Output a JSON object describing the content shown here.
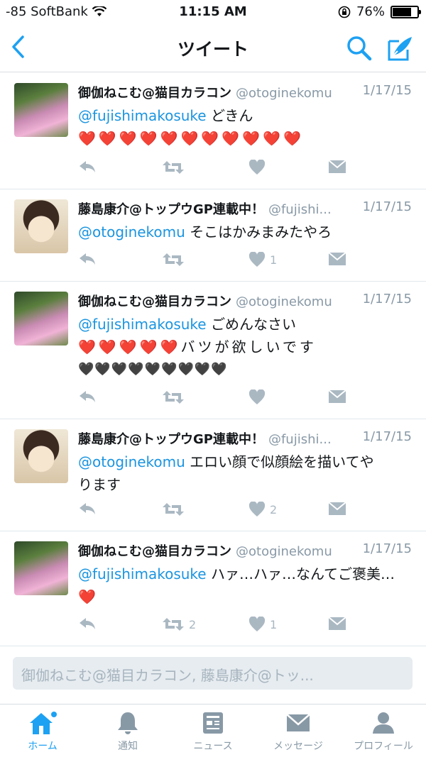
{
  "status_bar": {
    "carrier": "-85 SoftBank",
    "time": "11:15 AM",
    "battery": "76%",
    "battery_level": 0.76
  },
  "nav": {
    "title": "ツイート"
  },
  "tweets": [
    {
      "name": "御伽ねこむ@猫目カラコン",
      "handle": "@otoginekomu",
      "date": "1/17/15",
      "mention": "@fujishimakosuke",
      "text": " どきん",
      "line2": "❤️❤️❤️❤️❤️❤️❤️❤️❤️❤️❤️",
      "line3": "",
      "retweets": "",
      "likes": ""
    },
    {
      "name": "藤島康介@トップウGP連載中！",
      "handle": "@fujishi...",
      "date": "1/17/15",
      "mention": "@otoginekomu",
      "text": " そこはかみまみたやろ",
      "line2": "",
      "line3": "",
      "retweets": "",
      "likes": "1"
    },
    {
      "name": "御伽ねこむ@猫目カラコン",
      "handle": "@otoginekomu",
      "date": "1/17/15",
      "mention": "@fujishimakosuke",
      "text": " ごめんなさい",
      "line2": "❤️❤️❤️❤️❤️バツが欲しいです",
      "line3": "🖤🖤🖤🖤🖤🖤🖤🖤🖤",
      "retweets": "",
      "likes": ""
    },
    {
      "name": "藤島康介@トップウGP連載中！",
      "handle": "@fujishi...",
      "date": "1/17/15",
      "mention": "@otoginekomu",
      "text": " エロい顔で似顔絵を描いてや",
      "line2": "ります",
      "line3": "",
      "retweets": "",
      "likes": "2"
    },
    {
      "name": "御伽ねこむ@猫目カラコン",
      "handle": "@otoginekomu",
      "date": "1/17/15",
      "mention": "@fujishimakosuke",
      "text": " ハァ…ハァ…なんてご褒美…",
      "line2": "❤️",
      "line3": "",
      "retweets": "2",
      "likes": "1"
    }
  ],
  "reply_box": {
    "placeholder": "御伽ねこむ@猫目カラコン, 藤島康介@トッ..."
  },
  "tabs": [
    {
      "label": "ホーム",
      "icon": "home-icon",
      "active": true
    },
    {
      "label": "通知",
      "icon": "bell-icon"
    },
    {
      "label": "ニュース",
      "icon": "news-icon"
    },
    {
      "label": "メッセージ",
      "icon": "envelope-icon"
    },
    {
      "label": "プロフィール",
      "icon": "person-icon"
    }
  ],
  "colors": {
    "accent": "#1da1f2",
    "mention": "#1b95e0",
    "muted": "#8899a6",
    "action": "#aab8c2",
    "unread_dot": "#1da1f2"
  }
}
